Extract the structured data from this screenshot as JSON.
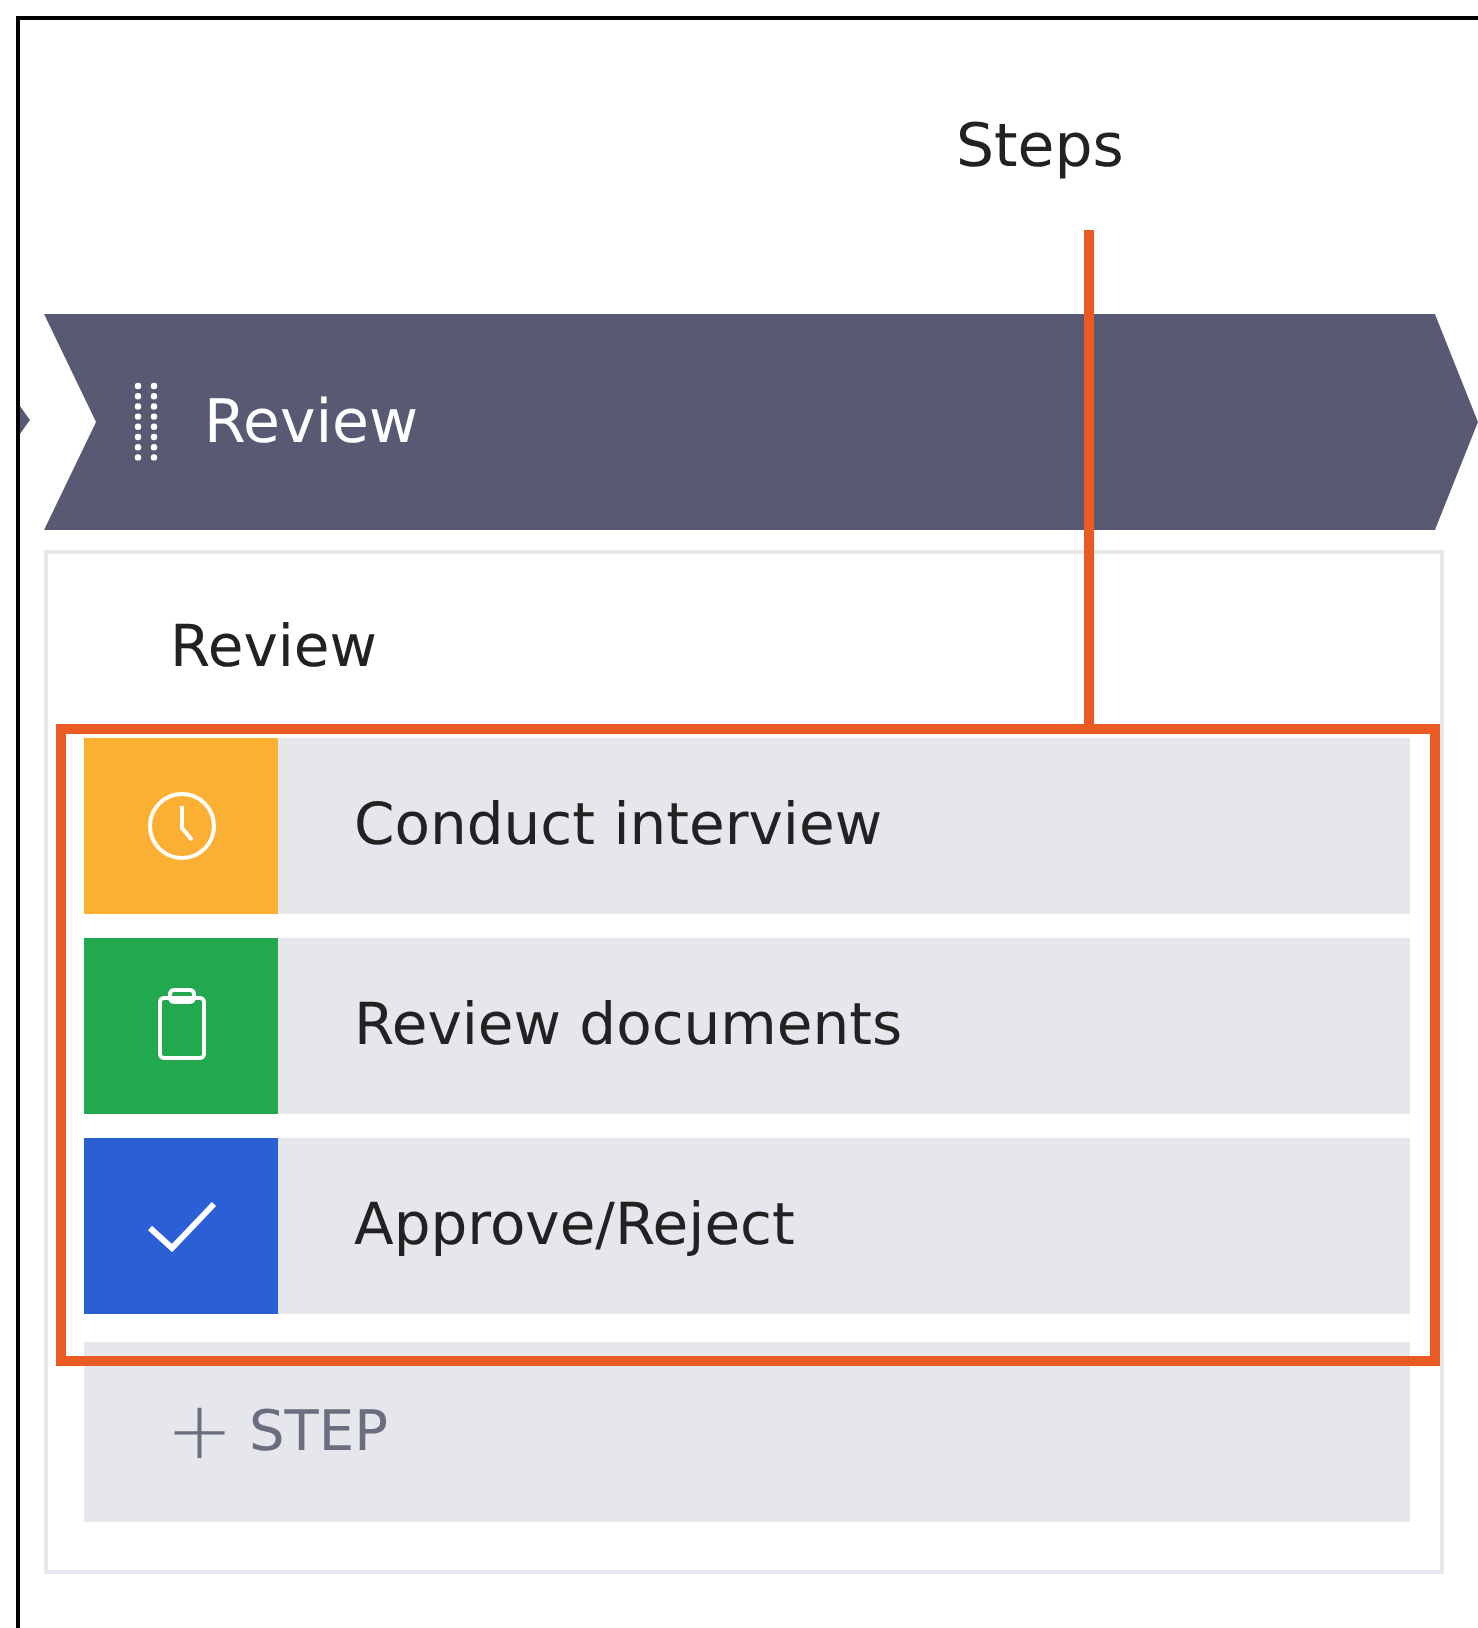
{
  "annotation": {
    "label": "Steps"
  },
  "stage": {
    "title": "Review"
  },
  "card": {
    "heading": "Review",
    "steps": [
      {
        "label": "Conduct interview",
        "kind": "clock",
        "color": "#fbb034"
      },
      {
        "label": "Review documents",
        "kind": "clipboard",
        "color": "#22a84f"
      },
      {
        "label": "Approve/Reject",
        "kind": "check",
        "color": "#2a5fd6"
      }
    ],
    "add_step": {
      "icon": "+",
      "label": "STEP"
    }
  }
}
